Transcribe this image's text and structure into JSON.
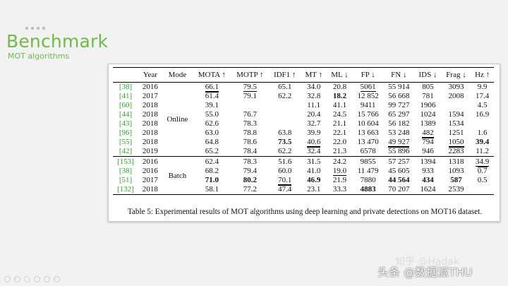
{
  "slide": {
    "title": "Benchmark",
    "subtitle": "MOT algorithms"
  },
  "table": {
    "headers": [
      "",
      "Year",
      "Mode",
      "MOTA ↑",
      "MOTP ↑",
      "IDF1 ↑",
      "MT ↑",
      "ML ↓",
      "FP ↓",
      "FN ↓",
      "IDS ↓",
      "Frag ↓",
      "Hz ↑"
    ],
    "modes": {
      "online": "Online",
      "batch": "Batch"
    },
    "online_rows": [
      {
        "cells": [
          "[38]",
          "2016",
          "",
          "66.1",
          "79.5",
          "65.1",
          "34.0",
          "20.8",
          "5061",
          "55 914",
          "805",
          "3093",
          "9.9"
        ],
        "ul": [
          3,
          4,
          8
        ],
        "ol": [],
        "bold": []
      },
      {
        "cells": [
          "[41]",
          "2017",
          "",
          "61.4",
          "79.1",
          "62.2",
          "32.8",
          "18.2",
          "12 852",
          "56 668",
          "781",
          "2008",
          "17.4"
        ],
        "ul": [],
        "ol": [
          3
        ],
        "bold": [
          7
        ]
      },
      {
        "cells": [
          "[60]",
          "2018",
          "",
          "39.1",
          "",
          "",
          "11.1",
          "41.1",
          "9411",
          "99 727",
          "1906",
          "",
          "4.5"
        ],
        "ul": [],
        "ol": [],
        "bold": []
      },
      {
        "cells": [
          "[44]",
          "2018",
          "",
          "55.0",
          "76.7",
          "",
          "20.4",
          "24.5",
          "15 766",
          "65 297",
          "1024",
          "1594",
          "16.9"
        ],
        "ul": [],
        "ol": [],
        "bold": []
      },
      {
        "cells": [
          "[43]",
          "2018",
          "",
          "62.6",
          "78.3",
          "",
          "32.7",
          "21.1",
          "10 604",
          "56 182",
          "1389",
          "1534",
          ""
        ],
        "ul": [],
        "ol": [],
        "bold": []
      },
      {
        "cells": [
          "[96]",
          "2018",
          "",
          "63.0",
          "78.8",
          "63.8",
          "39.9",
          "22.1",
          "13 663",
          "53 248",
          "482",
          "1251",
          "1.6"
        ],
        "ul": [
          10
        ],
        "ol": [],
        "bold": []
      },
      {
        "cells": [
          "[55]",
          "2018",
          "",
          "64.8",
          "78.6",
          "73.5",
          "40.6",
          "22.0",
          "13 470",
          "49 927",
          "794",
          "1050",
          "39.4"
        ],
        "ul": [
          6,
          9,
          11
        ],
        "ol": [
          10
        ],
        "bold": [
          5,
          12
        ]
      },
      {
        "cells": [
          "[42]",
          "2019",
          "",
          "65.2",
          "78.4",
          "62.2",
          "32.4",
          "21.3",
          "6578",
          "55 896",
          "946",
          "2283",
          "11.2"
        ],
        "ul": [],
        "ol": [
          6,
          9,
          11
        ],
        "bold": []
      }
    ],
    "batch_rows": [
      {
        "cells": [
          "[153]",
          "2016",
          "",
          "62.4",
          "78.3",
          "51.6",
          "31.5",
          "24.2",
          "9855",
          "57 257",
          "1394",
          "1318",
          "34.9"
        ],
        "ul": [
          12
        ],
        "ol": [],
        "bold": []
      },
      {
        "cells": [
          "[38]",
          "2016",
          "",
          "68.2",
          "79.4",
          "60.0",
          "41.0",
          "19.0",
          "11 479",
          "45 605",
          "933",
          "1093",
          "0.7"
        ],
        "ul": [
          7
        ],
        "ol": [
          12
        ],
        "bold": []
      },
      {
        "cells": [
          "[51]",
          "2017",
          "",
          "71.0",
          "80.2",
          "70.1",
          "46.9",
          "21.9",
          "7880",
          "44 564",
          "434",
          "587",
          "0.5"
        ],
        "ul": [
          5
        ],
        "ol": [],
        "bold": [
          3,
          4,
          6,
          9,
          10,
          11
        ]
      },
      {
        "cells": [
          "[132]",
          "2018",
          "",
          "58.1",
          "77.2",
          "47.4",
          "23.1",
          "33.3",
          "4883",
          "70 207",
          "1624",
          "2539",
          ""
        ],
        "ul": [],
        "ol": [
          5
        ],
        "bold": [
          8
        ]
      }
    ],
    "caption": "Table 5: Experimental results of MOT algorithms using deep learning and private detections on MOT16 dataset."
  },
  "watermark": {
    "faint": "知乎 @Hadak",
    "main": "头条 @数据派THU"
  },
  "colors": {
    "accent": "#6dbb45",
    "ref": "#2aa52a"
  }
}
